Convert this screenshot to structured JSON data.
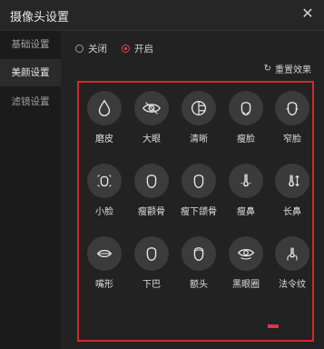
{
  "window": {
    "title": "摄像头设置"
  },
  "sidebar": {
    "items": [
      {
        "label": "基础设置"
      },
      {
        "label": "美颜设置"
      },
      {
        "label": "滤镜设置"
      }
    ]
  },
  "toggle": {
    "off_label": "关闭",
    "on_label": "开启",
    "selected": "开启"
  },
  "reset_label": "重置效果",
  "effects": [
    {
      "label": "磨皮",
      "icon": "drop-icon"
    },
    {
      "label": "大眼",
      "icon": "eye-icon"
    },
    {
      "label": "清晰",
      "icon": "clarity-icon"
    },
    {
      "label": "瘦脸",
      "icon": "face-slim-icon"
    },
    {
      "label": "窄脸",
      "icon": "face-narrow-icon"
    },
    {
      "label": "小脸",
      "icon": "small-face-icon"
    },
    {
      "label": "瘦颧骨",
      "icon": "cheekbone-icon"
    },
    {
      "label": "瘦下颌骨",
      "icon": "jaw-icon"
    },
    {
      "label": "瘦鼻",
      "icon": "nose-slim-icon"
    },
    {
      "label": "长鼻",
      "icon": "nose-long-icon"
    },
    {
      "label": "嘴形",
      "icon": "mouth-icon"
    },
    {
      "label": "下巴",
      "icon": "chin-icon"
    },
    {
      "label": "额头",
      "icon": "forehead-icon"
    },
    {
      "label": "黑眼圈",
      "icon": "dark-circle-icon"
    },
    {
      "label": "法令纹",
      "icon": "nasolabial-icon"
    }
  ]
}
